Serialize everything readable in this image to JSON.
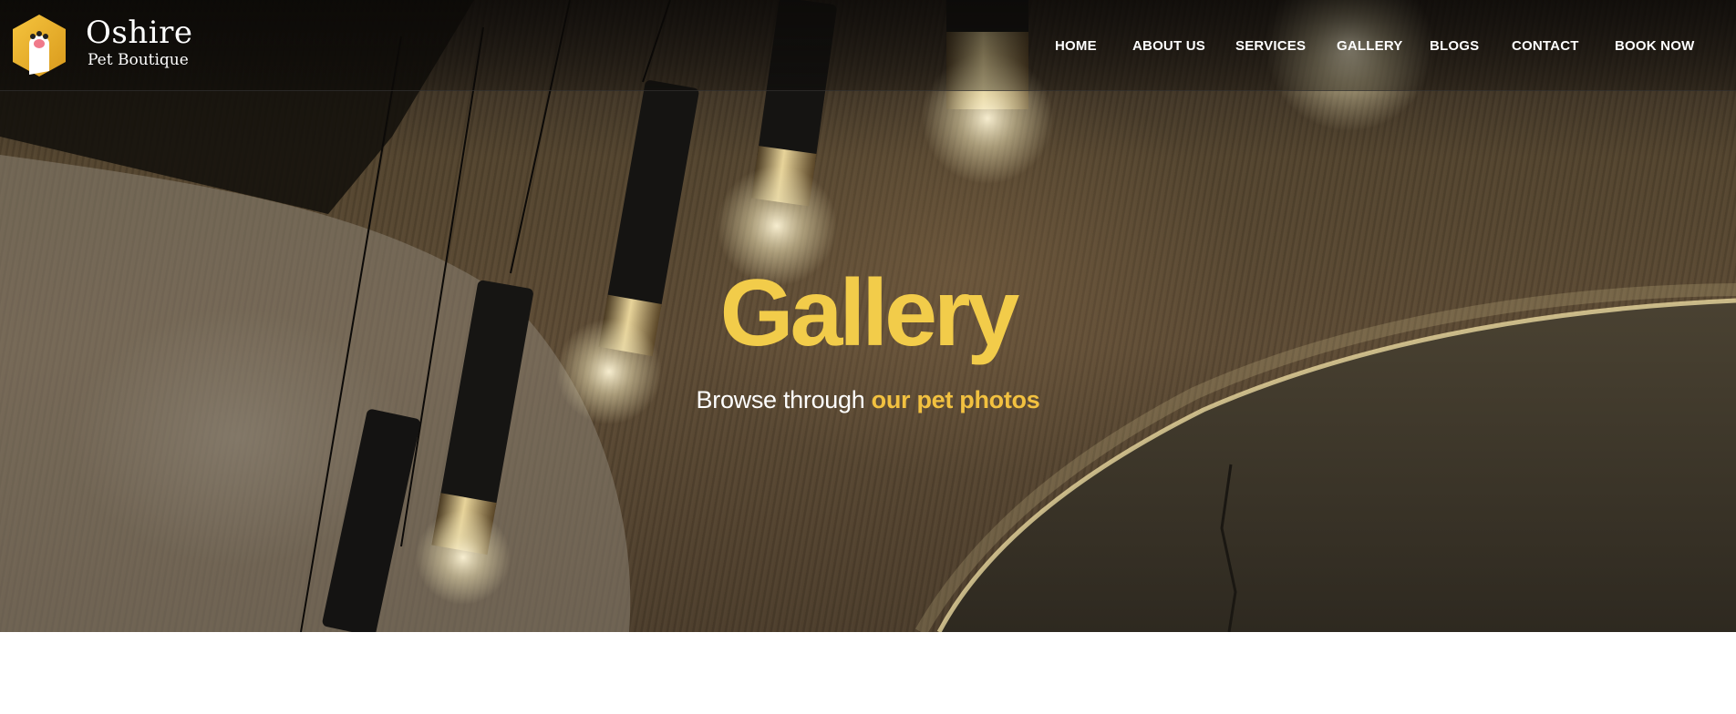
{
  "brand": {
    "name": "Oshire",
    "tagline": "Pet Boutique",
    "logo_icon": "cat-paw-hexagon-icon",
    "accent": "#f2cc4a"
  },
  "nav": {
    "items": [
      "HOME",
      "ABOUT US",
      "SERVICES",
      "GALLERY",
      "BLOGS",
      "CONTACT",
      "BOOK NOW"
    ]
  },
  "hero": {
    "title": "Gallery",
    "subtitle_lead": "Browse through",
    "subtitle_highlight": "our pet photos",
    "background": "pendant-lamps-photo"
  }
}
